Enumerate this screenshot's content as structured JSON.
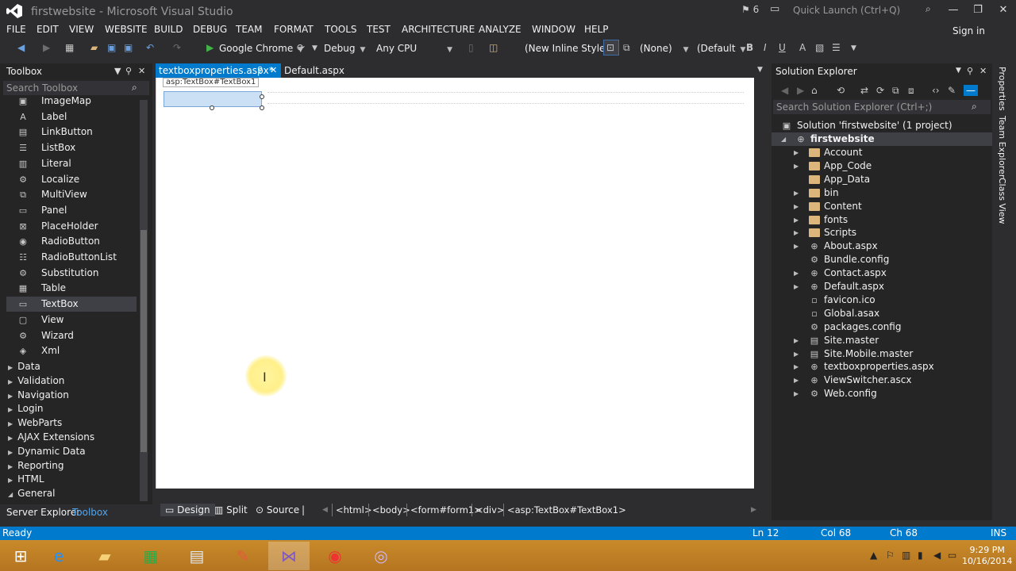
{
  "window": {
    "title": "firstwebsite - Microsoft Visual Studio",
    "notif_count": "6",
    "quick_launch_placeholder": "Quick Launch (Ctrl+Q)",
    "sign_in": "Sign in"
  },
  "menu": [
    "FILE",
    "EDIT",
    "VIEW",
    "WEBSITE",
    "BUILD",
    "DEBUG",
    "TEAM",
    "FORMAT",
    "TOOLS",
    "TEST",
    "ARCHITECTURE",
    "ANALYZE",
    "WINDOW",
    "HELP"
  ],
  "toolbar": {
    "run_target": "Google Chrome",
    "config": "Debug",
    "platform": "Any CPU",
    "style": "(New Inline Style",
    "target_rule": "(None)",
    "font": "(Default",
    "bold": "B",
    "italic": "I",
    "underline": "U"
  },
  "toolbox": {
    "title": "Toolbox",
    "search_placeholder": "Search Toolbox",
    "items": [
      {
        "label": "ImageMap",
        "icon": "▣"
      },
      {
        "label": "Label",
        "icon": "A"
      },
      {
        "label": "LinkButton",
        "icon": "▤"
      },
      {
        "label": "ListBox",
        "icon": "☰"
      },
      {
        "label": "Literal",
        "icon": "▥"
      },
      {
        "label": "Localize",
        "icon": "⚙"
      },
      {
        "label": "MultiView",
        "icon": "⧉"
      },
      {
        "label": "Panel",
        "icon": "▭"
      },
      {
        "label": "PlaceHolder",
        "icon": "⊠"
      },
      {
        "label": "RadioButton",
        "icon": "◉"
      },
      {
        "label": "RadioButtonList",
        "icon": "☷"
      },
      {
        "label": "Substitution",
        "icon": "⚙"
      },
      {
        "label": "Table",
        "icon": "▦"
      },
      {
        "label": "TextBox",
        "icon": "▭"
      },
      {
        "label": "View",
        "icon": "▢"
      },
      {
        "label": "Wizard",
        "icon": "⚙"
      },
      {
        "label": "Xml",
        "icon": "◈"
      }
    ],
    "categories": [
      "Data",
      "Validation",
      "Navigation",
      "Login",
      "WebParts",
      "AJAX Extensions",
      "Dynamic Data",
      "Reporting",
      "HTML",
      "General"
    ],
    "bottom_tabs": [
      "Server Explorer",
      "Toolbox"
    ]
  },
  "editor": {
    "tabs": [
      {
        "label": "textboxproperties.aspx*"
      },
      {
        "label": "Default.aspx"
      }
    ],
    "control_tag": "asp:TextBox#TextBox1",
    "views": [
      "Design",
      "Split",
      "Source"
    ],
    "breadcrumbs": [
      "<html>",
      "<body>",
      "<form#form1>",
      "<div>",
      "<asp:TextBox#TextBox1>"
    ]
  },
  "solution_explorer": {
    "title": "Solution Explorer",
    "search_placeholder": "Search Solution Explorer (Ctrl+;)",
    "solution": "Solution 'firstwebsite' (1 project)",
    "project": "firstwebsite",
    "items": [
      {
        "label": "Account",
        "type": "folder",
        "expandable": true
      },
      {
        "label": "App_Code",
        "type": "folder",
        "expandable": true
      },
      {
        "label": "App_Data",
        "type": "folder",
        "expandable": false
      },
      {
        "label": "bin",
        "type": "folder",
        "expandable": true
      },
      {
        "label": "Content",
        "type": "folder",
        "expandable": true
      },
      {
        "label": "fonts",
        "type": "folder",
        "expandable": true
      },
      {
        "label": "Scripts",
        "type": "folder",
        "expandable": true
      },
      {
        "label": "About.aspx",
        "type": "web",
        "expandable": true
      },
      {
        "label": "Bundle.config",
        "type": "config",
        "expandable": false
      },
      {
        "label": "Contact.aspx",
        "type": "web",
        "expandable": true
      },
      {
        "label": "Default.aspx",
        "type": "web",
        "expandable": true
      },
      {
        "label": "favicon.ico",
        "type": "file",
        "expandable": false
      },
      {
        "label": "Global.asax",
        "type": "file",
        "expandable": false
      },
      {
        "label": "packages.config",
        "type": "config",
        "expandable": false
      },
      {
        "label": "Site.master",
        "type": "master",
        "expandable": true
      },
      {
        "label": "Site.Mobile.master",
        "type": "master",
        "expandable": true
      },
      {
        "label": "textboxproperties.aspx",
        "type": "web",
        "expandable": true
      },
      {
        "label": "ViewSwitcher.ascx",
        "type": "web",
        "expandable": true
      },
      {
        "label": "Web.config",
        "type": "config",
        "expandable": true
      }
    ]
  },
  "side_tabs": [
    "Properties",
    "Team Explorer",
    "Class View"
  ],
  "status": {
    "ready": "Ready",
    "ln": "Ln 12",
    "col": "Col 68",
    "ch": "Ch 68",
    "mode": "INS"
  },
  "taskbar": {
    "time": "9:29 PM",
    "date": "10/16/2014"
  },
  "colors": {
    "accent": "#007acc",
    "background": "#2d2d30",
    "panel": "#252526",
    "folder": "#dcb67a"
  }
}
